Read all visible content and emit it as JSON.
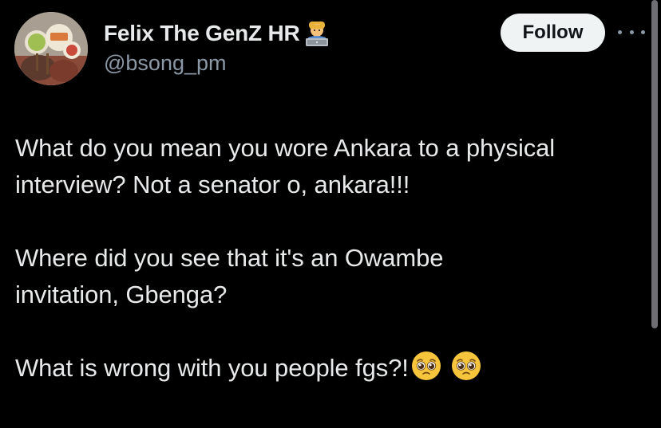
{
  "tweet": {
    "author": {
      "display_name": "Felix The GenZ HR",
      "name_emoji": "technologist-emoji-icon",
      "handle": "@bsong_pm"
    },
    "follow_label": "Follow",
    "more_icon": "more-horizontal-icon",
    "paragraphs": [
      {
        "line1": "What do you mean you wore Ankara to a physical",
        "line2": "interview? Not a senator o, ankara!!!"
      },
      {
        "line1": "Where did you see that it's an Owambe",
        "line2": "invitation, Gbenga?"
      },
      {
        "line1": "What is wrong with you people fgs?!",
        "emojis": [
          "pleading-face-icon",
          "pleading-face-icon"
        ]
      }
    ]
  },
  "colors": {
    "background": "#000000",
    "primary_text": "#e7e9ea",
    "secondary_text": "#8b98a5",
    "follow_button_bg": "#eff3f4",
    "follow_button_text": "#0f1419",
    "scrollbar": "#6e6e73"
  }
}
